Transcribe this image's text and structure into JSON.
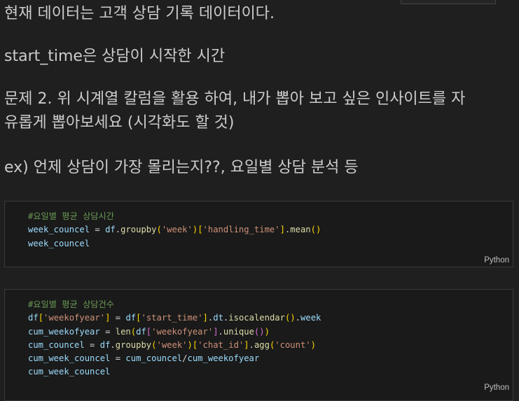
{
  "markdown": {
    "line1": "현재 데이터는 고객 상담 기록 데이터이다.",
    "line2": "start_time은 상담이 시작한 시간",
    "line3": "문제 2. 위 시계열 칼럼을 활용 하여, 내가 뽑아 보고 싶은 인사이트를 자",
    "line4": "유롭게 뽑아보세요 (시각화도 할 것)",
    "line5": "ex) 언제 상담이 가장 몰리는지??, 요일별 상담 분석 등"
  },
  "cell1": {
    "comment": "#요일별 평균 상담시간",
    "l2": {
      "v1": "week_councel",
      "eq": " = ",
      "df": "df",
      "dot": ".",
      "fn": "groupby",
      "s1": "'week'",
      "s2": "'handling_time'",
      "fn2": "mean"
    },
    "l3": "week_councel",
    "language": "Python"
  },
  "cell2": {
    "comment": "#요일별 평균 상담건수",
    "l2": {
      "df": "df",
      "s1": "'weekofyear'",
      "eq": " = ",
      "df2": "df",
      "s2": "'start_time'",
      "dt": "dt",
      "fn": "isocalendar",
      "wk": "week"
    },
    "l3": {
      "v": "cum_weekofyear",
      "eq": " = ",
      "fn": "len",
      "df": "df",
      "s": "'weekofyear'",
      "fn2": "unique"
    },
    "l4": {
      "v": "cum_councel",
      "eq": " = ",
      "df": "df",
      "fn": "groupby",
      "s1": "'week'",
      "s2": "'chat_id'",
      "fn2": "agg",
      "s3": "'count'"
    },
    "l5": {
      "v": "cum_week_councel",
      "eq": " = ",
      "a": "cum_councel",
      "op": "/",
      "b": "cum_weekofyear"
    },
    "l6": "cum_week_councel",
    "language": "Python"
  }
}
